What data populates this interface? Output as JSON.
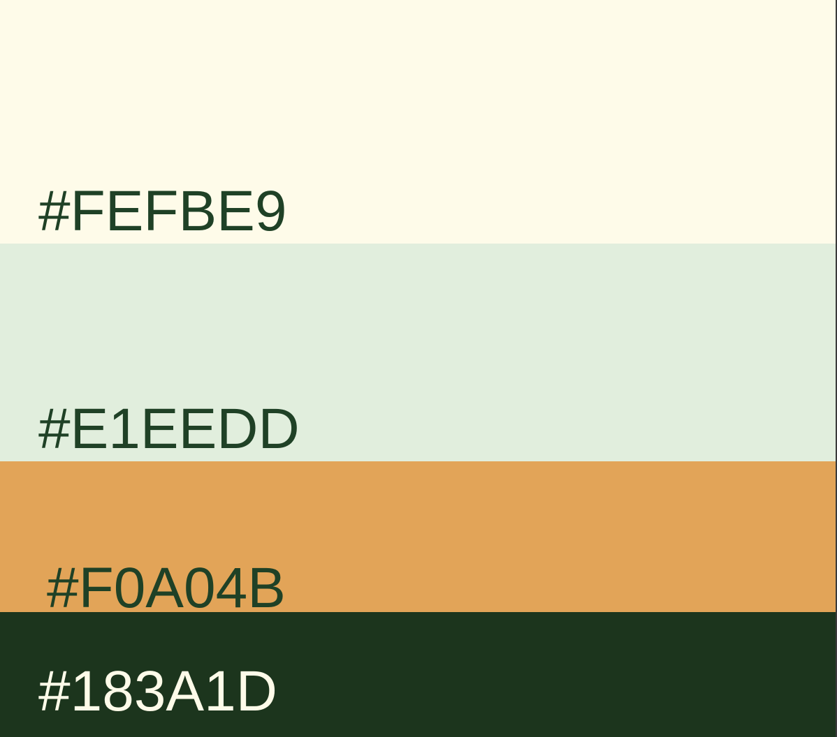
{
  "swatches": [
    {
      "hex": "#FEFBE9",
      "fill": "#FEFBE9",
      "text_color": "#1f4126"
    },
    {
      "hex": "#E1EEDD",
      "fill": "#E1EEDD",
      "text_color": "#1f4126"
    },
    {
      "hex": "#F0A04B",
      "fill": "#E2A458",
      "text_color": "#1f4126"
    },
    {
      "hex": "#183A1D",
      "fill": "#1C351D",
      "text_color": "#FEFBE9"
    }
  ]
}
